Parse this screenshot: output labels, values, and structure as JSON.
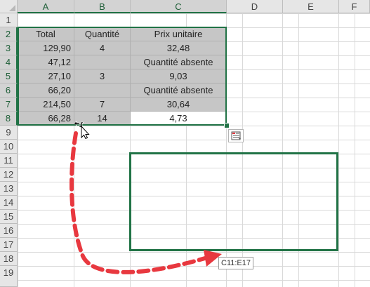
{
  "columns": [
    "A",
    "B",
    "C",
    "D",
    "E",
    "F"
  ],
  "rows": [
    "1",
    "2",
    "3",
    "4",
    "5",
    "6",
    "7",
    "8",
    "9",
    "10",
    "11",
    "12",
    "13",
    "14",
    "15",
    "16",
    "17",
    "18",
    "19"
  ],
  "table": {
    "headers": [
      "Total",
      "Quantité",
      "Prix unitaire"
    ],
    "rows": [
      [
        "129,90",
        "4",
        "32,48"
      ],
      [
        "47,12",
        "",
        "Quantité absente"
      ],
      [
        "27,10",
        "3",
        "9,03"
      ],
      [
        "66,20",
        "",
        "Quantité absente"
      ],
      [
        "214,50",
        "7",
        "30,64"
      ],
      [
        "66,28",
        "14",
        "4,73"
      ]
    ]
  },
  "drag_tooltip": "C11:E17",
  "icons": {
    "select_all": "select-all-triangle-icon",
    "quick_analysis": "quick-analysis-icon",
    "cursor": "move-cursor-icon",
    "arrow": "curved-dashed-arrow-icon"
  },
  "colors": {
    "selection": "#217346",
    "shaded_cells": "#c6c6c6",
    "arrow": "#e8383f",
    "header_bg": "#e6e6e6"
  }
}
